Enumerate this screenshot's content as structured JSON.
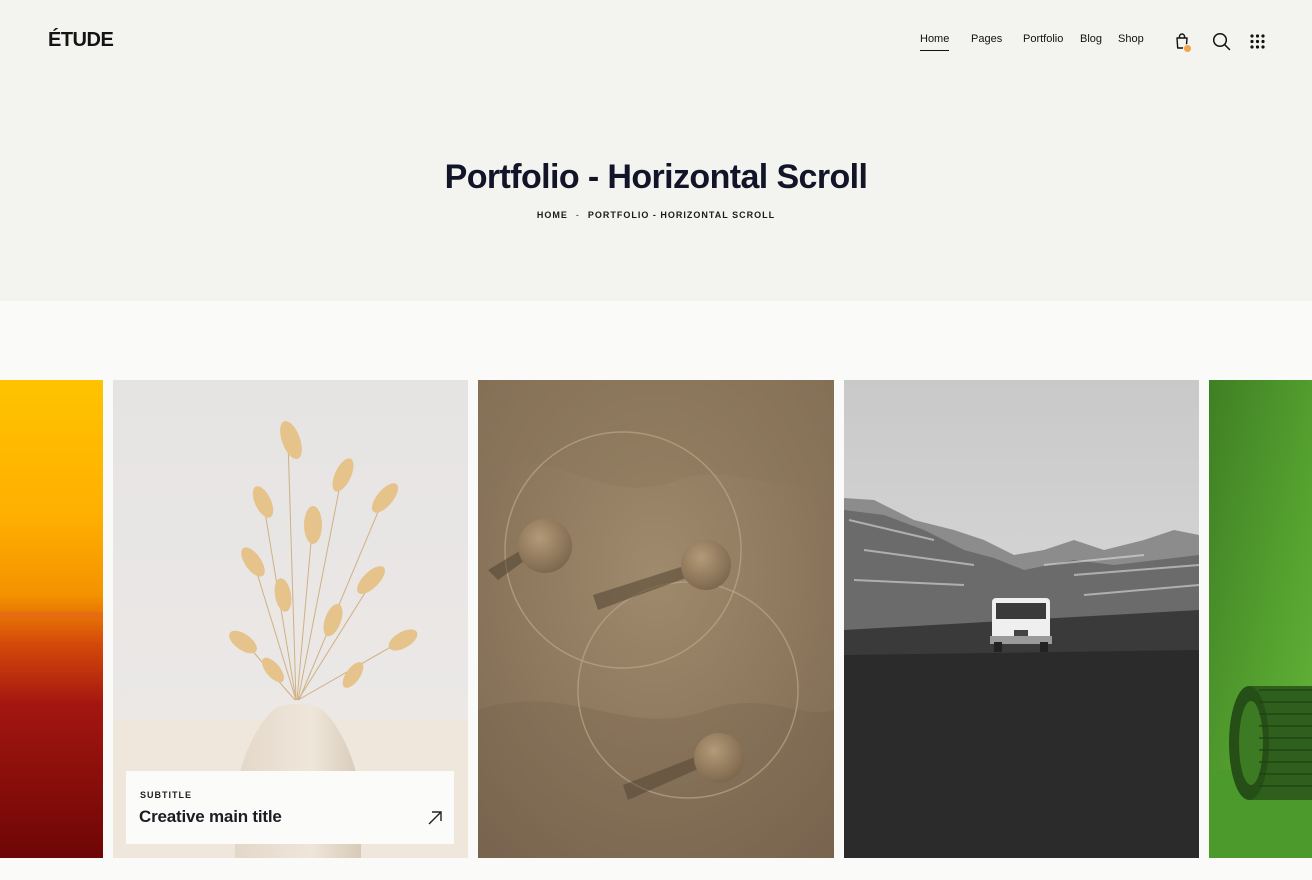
{
  "brand": {
    "logo": "ÉTUDE"
  },
  "nav": {
    "items": [
      {
        "label": "Home",
        "active": true
      },
      {
        "label": "Pages",
        "active": false
      },
      {
        "label": "Portfolio",
        "active": false
      },
      {
        "label": "Blog",
        "active": false
      },
      {
        "label": "Shop",
        "active": false
      }
    ]
  },
  "header_icons": [
    "shopping-bag-icon",
    "search-icon",
    "grid-menu-icon"
  ],
  "hero": {
    "title": "Portfolio - Horizontal Scroll"
  },
  "breadcrumb": {
    "home": "HOME",
    "separator": "-",
    "current": "PORTFOLIO - HORIZONTAL SCROLL"
  },
  "portfolio": {
    "items": [
      {
        "image": "orange-sunset-abstract"
      },
      {
        "image": "dried-grass-in-white-vase"
      },
      {
        "image": "sand-with-glass-circles-and-spheres"
      },
      {
        "image": "black-white-van-in-mountains"
      },
      {
        "image": "green-cylinder-object"
      }
    ],
    "card": {
      "subtitle": "SUBTITLE",
      "title": "Creative main title"
    }
  },
  "colors": {
    "accent_badge": "#f1a44b",
    "hero_bg": "#f3f3f0",
    "text_dark": "#121528"
  }
}
